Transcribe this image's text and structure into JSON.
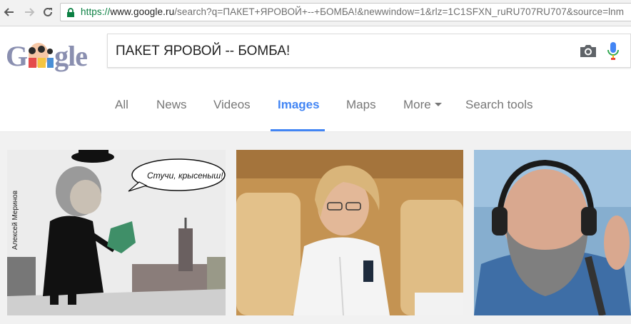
{
  "browser": {
    "url_scheme": "https://",
    "url_host": "www.google.ru",
    "url_rest": "/search?q=ПАКЕТ+ЯРОВОЙ+--+БОМБА!&newwindow=1&rlz=1C1SFXN_ruRU707RU707&source=lnm"
  },
  "search": {
    "query": "ПАКЕТ ЯРОВОЙ -- БОМБА!"
  },
  "logo": {
    "text": "Google"
  },
  "tabs": [
    {
      "label": "All"
    },
    {
      "label": "News"
    },
    {
      "label": "Videos"
    },
    {
      "label": "Images",
      "active": true
    },
    {
      "label": "Maps"
    },
    {
      "label": "More"
    },
    {
      "label": "Search tools"
    }
  ],
  "results": {
    "cartoon_speech": "Стучи, крысеныш!",
    "cartoon_signature": "Алексей Меринов"
  },
  "colors": {
    "accent": "#4285f4",
    "secure_green": "#0b8043",
    "mic_blue": "#4285f4",
    "mic_red": "#ea4335"
  }
}
